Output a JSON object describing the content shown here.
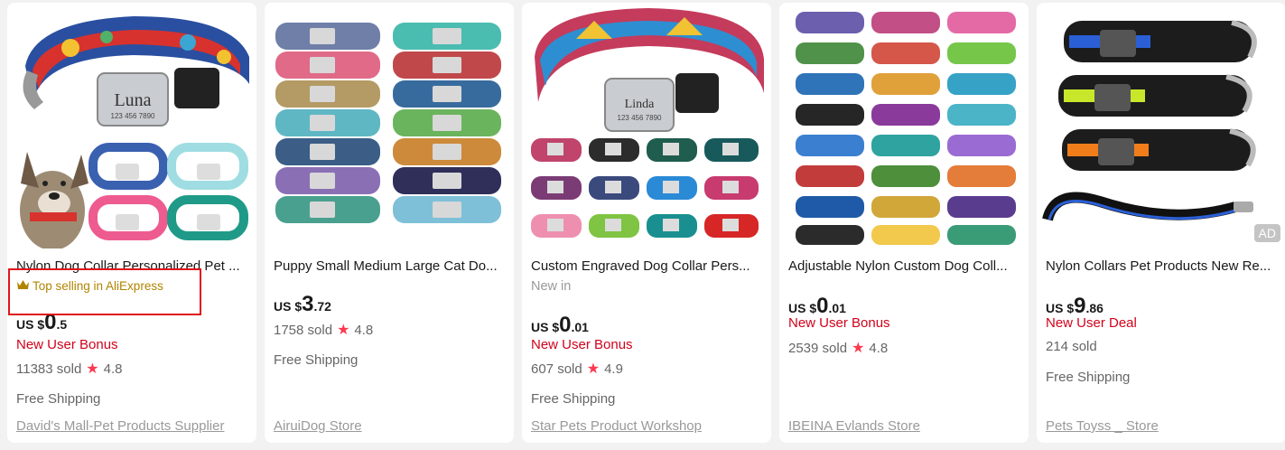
{
  "products": [
    {
      "title": "Nylon Dog Collar Personalized Pet ...",
      "badge": "Top selling in AliExpress",
      "currency": "US $",
      "price_int": "0",
      "price_dec": ".5",
      "bonus": "New User Bonus",
      "sold": "11383 sold",
      "rating": "4.8",
      "shipping": "Free Shipping",
      "store": "David's Mall-Pet Products Supplier",
      "collar_label": "Luna",
      "collar_phone": "123 456 7890"
    },
    {
      "title": "Puppy Small Medium Large Cat Do...",
      "currency": "US $",
      "price_int": "3",
      "price_dec": ".72",
      "sold": "1758 sold",
      "rating": "4.8",
      "shipping": "Free Shipping",
      "store": "AiruiDog Store"
    },
    {
      "title": "Custom Engraved Dog Collar Pers...",
      "tag": "New in",
      "currency": "US $",
      "price_int": "0",
      "price_dec": ".01",
      "bonus": "New User Bonus",
      "sold": "607 sold",
      "rating": "4.9",
      "shipping": "Free Shipping",
      "store": "Star Pets Product Workshop",
      "collar_label": "Linda",
      "collar_phone": "123 456 7890"
    },
    {
      "title": "Adjustable Nylon Custom Dog Coll...",
      "currency": "US $",
      "price_int": "0",
      "price_dec": ".01",
      "bonus": "New User Bonus",
      "sold": "2539 sold",
      "rating": "4.8",
      "store": "IBEINA Evlands Store"
    },
    {
      "title": "Nylon Collars Pet Products New Re...",
      "currency": "US $",
      "price_int": "9",
      "price_dec": ".86",
      "bonus": "New User Deal",
      "sold": "214 sold",
      "shipping": "Free Shipping",
      "store": "Pets Toyss _ Store",
      "ad_label": "AD"
    }
  ],
  "icons": {
    "star": "star-icon",
    "crown": "crown-icon"
  },
  "colors": {
    "price": "#191919",
    "bonus": "#d0021b",
    "star": "#fd384f",
    "badge": "#b08400",
    "highlight": "#e0141c"
  }
}
